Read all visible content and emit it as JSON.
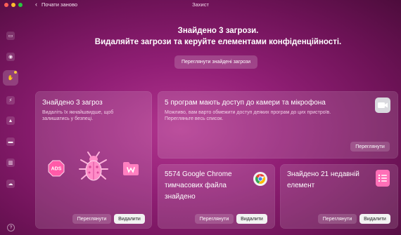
{
  "window": {
    "back_label": "Почати заново",
    "title": "Захист"
  },
  "sidebar": {
    "items": [
      {
        "icon": "monitor-icon"
      },
      {
        "icon": "database-icon"
      },
      {
        "icon": "hand-icon"
      },
      {
        "icon": "bolt-icon"
      },
      {
        "icon": "rocket-icon"
      },
      {
        "icon": "folder-icon"
      },
      {
        "icon": "trash-icon"
      },
      {
        "icon": "cloud-icon"
      }
    ],
    "help": "?"
  },
  "hero": {
    "line1": "Знайдено 3 загрози.",
    "line2": "Видаляйте загрози та керуйте елементами конфіденційності.",
    "button": "Переглянути знайдені загрози"
  },
  "threats_card": {
    "title": "Знайдено 3 загроз",
    "desc_line1": "Видаліть їх якнайшвидше, щоб",
    "desc_line2": "залишатись у безпеці.",
    "ads_label": "ADS",
    "review": "Переглянути",
    "remove": "Видалити"
  },
  "camera_card": {
    "title": "5 програм мають доступ до камери та мікрофона",
    "desc_line1": "Можливо, вам варто обмежити доступ деяких програм до цих пристроїв.",
    "desc_line2": "Перегляньте весь список.",
    "review": "Переглянути"
  },
  "chrome_card": {
    "title_line1": "5574 Google Chrome",
    "title_line2": "тимчасових файла",
    "title_line3": "знайдено",
    "review": "Переглянути",
    "remove": "Видалити"
  },
  "recent_card": {
    "title_line1": "Знайдено 21 недавній",
    "title_line2": "елемент",
    "review": "Переглянути",
    "remove": "Видалити"
  },
  "colors": {
    "bg": "#921f76",
    "accent_pink": "#ff6fb7",
    "button_solid": "#f2f2f2"
  }
}
